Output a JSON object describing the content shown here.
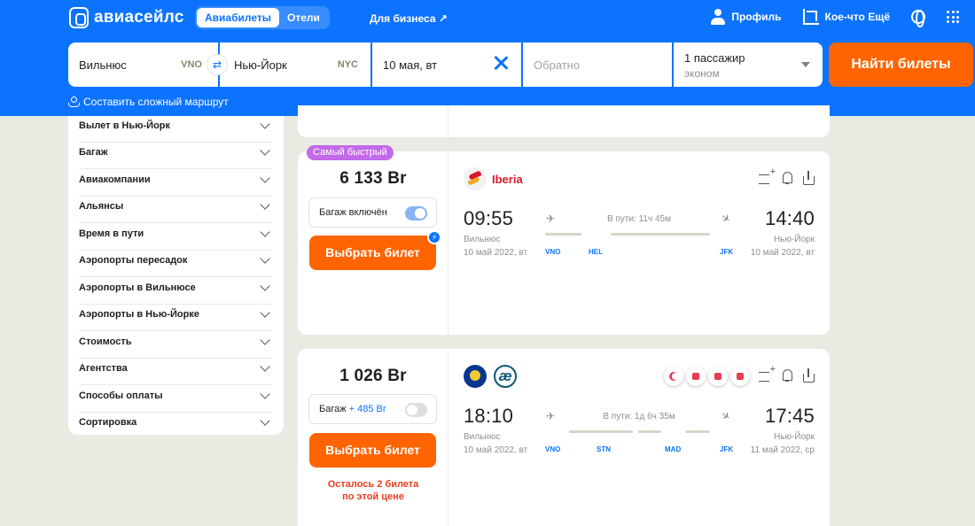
{
  "header": {
    "logo": "авиасейлс",
    "tabs": [
      "Авиабилеты",
      "Отели"
    ],
    "business": "Для бизнеса ↗",
    "profile": "Профиль",
    "more": "Кое-что Ещё"
  },
  "search": {
    "from_city": "Вильнюс",
    "from_code": "VNO",
    "to_city": "Нью-Йорк",
    "to_code": "NYC",
    "date": "10 мая, вт",
    "return_placeholder": "Обратно",
    "passengers": "1 пассажир",
    "class": "эконом",
    "find_button": "Найти билеты",
    "complex_route": "Составить сложный маршрут"
  },
  "filters": [
    "Вылет в Нью-Йорк",
    "Багаж",
    "Авиакомпании",
    "Альянсы",
    "Время в пути",
    "Аэропорты пересадок",
    "Аэропорты в Вильнюсе",
    "Аэропорты в Нью-Йорке",
    "Стоимость",
    "Агентства",
    "Способы оплаты",
    "Сортировка"
  ],
  "tickets": [
    {
      "badge": "Самый быстрый",
      "price": "6 133 Br",
      "baggage": "Багаж включён",
      "baggage_extra": "",
      "select": "Выбрать билет",
      "warning": "",
      "airline": "Iberia",
      "depart_time": "09:55",
      "depart_city": "Вильнюс",
      "depart_date": "10 май 2022, вт",
      "arrive_time": "14:40",
      "arrive_city": "Нью-Йорк",
      "arrive_date": "10 май 2022, вт",
      "duration": "В пути: 11ч 45м",
      "airports": [
        "VNO",
        "HEL",
        "JFK"
      ]
    },
    {
      "badge": "",
      "price": "1 026 Br",
      "baggage": "Багаж",
      "baggage_extra": "+ 485 Br",
      "select": "Выбрать билет",
      "warning_line1": "Осталось 2 билета",
      "warning_line2": "по этой цене",
      "airline": "",
      "depart_time": "18:10",
      "depart_city": "Вильнюс",
      "depart_date": "10 май 2022, вт",
      "arrive_time": "17:45",
      "arrive_city": "Нью-Йорк",
      "arrive_date": "11 май 2022, ср",
      "duration": "В пути: 1д 6ч 35м",
      "airports": [
        "VNO",
        "STN",
        "MAD",
        "JFK"
      ]
    }
  ],
  "colors": {
    "brand": "#0c73fe",
    "accent": "#ff6400",
    "badge": "#c36ae8",
    "warning": "#e93d1e"
  }
}
